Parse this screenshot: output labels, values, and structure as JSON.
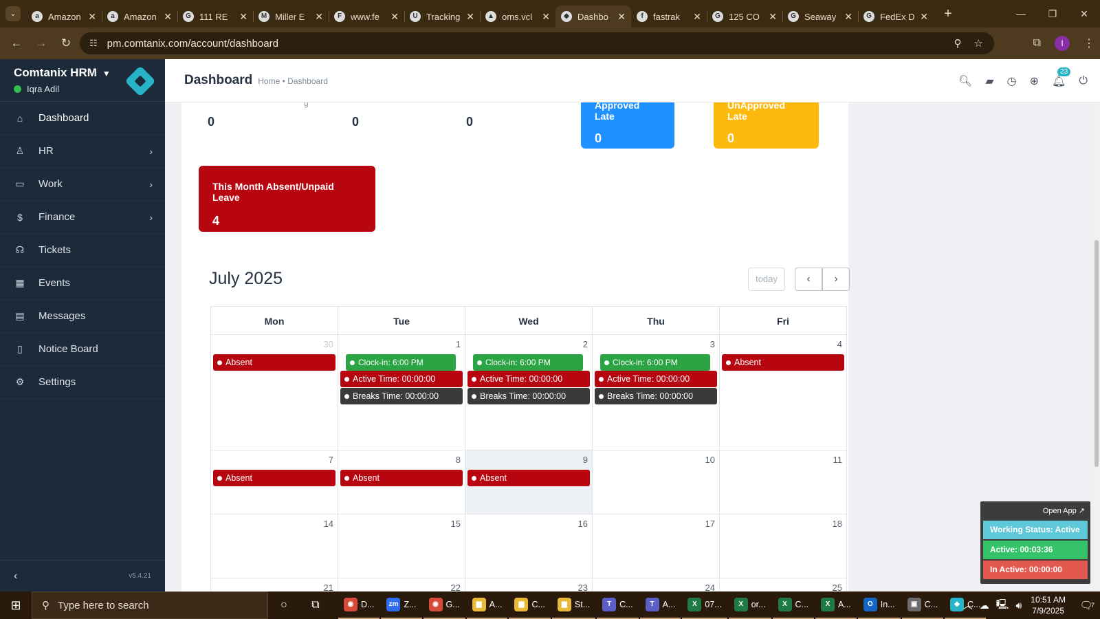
{
  "browser": {
    "tabs": [
      {
        "title": "Amazon",
        "icon": "amazon-icon",
        "fav": "a"
      },
      {
        "title": "Amazon",
        "icon": "amazon-icon",
        "fav": "a"
      },
      {
        "title": "111 RE",
        "icon": "google-icon",
        "fav": "G"
      },
      {
        "title": "Miller E",
        "icon": "miller-icon",
        "fav": "M"
      },
      {
        "title": "www.fe",
        "icon": "fedex-icon",
        "fav": "F"
      },
      {
        "title": "Tracking",
        "icon": "ups-icon",
        "fav": "U"
      },
      {
        "title": "oms.vcl",
        "icon": "oms-icon",
        "fav": "▲"
      },
      {
        "title": "Dashbo",
        "icon": "comtanix-icon",
        "fav": "◆"
      },
      {
        "title": "fastrak",
        "icon": "fastrak-icon",
        "fav": "f"
      },
      {
        "title": "125 CO",
        "icon": "google-icon",
        "fav": "G"
      },
      {
        "title": "Seaway",
        "icon": "google-icon",
        "fav": "G"
      },
      {
        "title": "FedEx D",
        "icon": "google-icon",
        "fav": "G"
      }
    ],
    "url": "pm.comtanix.com/account/dashboard",
    "profile_initial": "I"
  },
  "sidebar": {
    "brand": "Comtanix HRM",
    "user": "Iqra Adil",
    "items": [
      {
        "label": "Dashboard",
        "icon": "home-icon",
        "glyph": "⌂",
        "arrow": false
      },
      {
        "label": "HR",
        "icon": "users-icon",
        "glyph": "♙",
        "arrow": true
      },
      {
        "label": "Work",
        "icon": "briefcase-icon",
        "glyph": "▭",
        "arrow": true
      },
      {
        "label": "Finance",
        "icon": "dollar-icon",
        "glyph": "$",
        "arrow": true
      },
      {
        "label": "Tickets",
        "icon": "headset-icon",
        "glyph": "☊",
        "arrow": false
      },
      {
        "label": "Events",
        "icon": "calendar-icon",
        "glyph": "▦",
        "arrow": false
      },
      {
        "label": "Messages",
        "icon": "message-icon",
        "glyph": "▤",
        "arrow": false
      },
      {
        "label": "Notice Board",
        "icon": "clipboard-icon",
        "glyph": "▯",
        "arrow": false
      },
      {
        "label": "Settings",
        "icon": "gear-icon",
        "glyph": "⚙",
        "arrow": false
      }
    ],
    "version": "v5.4.21"
  },
  "header": {
    "title": "Dashboard",
    "breadcrumb_home": "Home",
    "breadcrumb_sep": "•",
    "breadcrumb_current": "Dashboard",
    "notification_count": "23"
  },
  "stats": {
    "values": [
      "0",
      "0",
      "0"
    ],
    "label_fragment": "g",
    "approved_late_label": "Approved Late",
    "approved_late_value": "0",
    "unapproved_late_label": "UnApproved Late",
    "unapproved_late_value": "0",
    "absent_label": "This Month Absent/Unpaid Leave",
    "absent_value": "4"
  },
  "colors": {
    "approved": "#1e90ff",
    "unapproved": "#fdba0d",
    "absent": "#b7060f"
  },
  "calendar": {
    "title": "July 2025",
    "today_label": "today",
    "days": [
      "Mon",
      "Tue",
      "Wed",
      "Thu",
      "Fri"
    ],
    "weeks": [
      {
        "height": 168,
        "cells": [
          {
            "num": "30",
            "other": true,
            "events": [
              {
                "type": "absent",
                "text": "Absent"
              }
            ]
          },
          {
            "num": "1",
            "events": [
              {
                "type": "clock",
                "text": "Clock-in: 6:00 PM"
              },
              {
                "type": "active",
                "text": "Active Time: 00:00:00"
              },
              {
                "type": "breaks",
                "text": "Breaks Time: 00:00:00"
              }
            ]
          },
          {
            "num": "2",
            "events": [
              {
                "type": "clock",
                "text": "Clock-in: 6:00 PM"
              },
              {
                "type": "active",
                "text": "Active Time: 00:00:00"
              },
              {
                "type": "breaks",
                "text": "Breaks Time: 00:00:00"
              }
            ]
          },
          {
            "num": "3",
            "events": [
              {
                "type": "clock",
                "text": "Clock-in: 6:00 PM"
              },
              {
                "type": "active",
                "text": "Active Time: 00:00:00"
              },
              {
                "type": "breaks",
                "text": "Breaks Time: 00:00:00"
              }
            ]
          },
          {
            "num": "4",
            "events": [
              {
                "type": "absent",
                "text": "Absent"
              }
            ]
          }
        ]
      },
      {
        "height": 93,
        "cells": [
          {
            "num": "7",
            "events": [
              {
                "type": "absent",
                "text": "Absent"
              }
            ]
          },
          {
            "num": "8",
            "events": [
              {
                "type": "absent",
                "text": "Absent"
              }
            ]
          },
          {
            "num": "9",
            "today": true,
            "events": [
              {
                "type": "absent",
                "text": "Absent"
              }
            ]
          },
          {
            "num": "10",
            "events": []
          },
          {
            "num": "11",
            "events": []
          }
        ]
      },
      {
        "height": 93,
        "cells": [
          {
            "num": "14",
            "events": []
          },
          {
            "num": "15",
            "events": []
          },
          {
            "num": "16",
            "events": []
          },
          {
            "num": "17",
            "events": []
          },
          {
            "num": "18",
            "events": []
          }
        ]
      },
      {
        "height": 40,
        "cells": [
          {
            "num": "21",
            "events": []
          },
          {
            "num": "22",
            "events": []
          },
          {
            "num": "23",
            "events": []
          },
          {
            "num": "24",
            "events": []
          },
          {
            "num": "25",
            "events": []
          }
        ]
      }
    ]
  },
  "widget": {
    "open_app": "Open App ↗",
    "working_status": "Working Status: Active",
    "active": "Active: 00:03:36",
    "inactive": "In Active: 00:00:00"
  },
  "taskbar": {
    "search_placeholder": "Type here to search",
    "apps": [
      {
        "label": "D...",
        "color": "#d64a3a",
        "icon": "chrome-icon",
        "glyph": "◉"
      },
      {
        "label": "Z...",
        "color": "#2d6cf0",
        "icon": "zoom-icon",
        "glyph": "zm"
      },
      {
        "label": "G...",
        "color": "#d64a3a",
        "icon": "chrome-icon",
        "glyph": "◉"
      },
      {
        "label": "A...",
        "color": "#e8b936",
        "icon": "folder-icon",
        "glyph": "▆"
      },
      {
        "label": "C...",
        "color": "#e8b936",
        "icon": "folder-icon",
        "glyph": "▆"
      },
      {
        "label": "St...",
        "color": "#e8b936",
        "icon": "folder-icon",
        "glyph": "▆"
      },
      {
        "label": "C...",
        "color": "#5b5fc7",
        "icon": "teams-icon",
        "glyph": "T"
      },
      {
        "label": "A...",
        "color": "#5b5fc7",
        "icon": "teams-icon",
        "glyph": "T"
      },
      {
        "label": "07...",
        "color": "#1f7a45",
        "icon": "excel-icon",
        "glyph": "X"
      },
      {
        "label": "or...",
        "color": "#1f7a45",
        "icon": "excel-icon",
        "glyph": "X"
      },
      {
        "label": "C...",
        "color": "#1f7a45",
        "icon": "excel-icon",
        "glyph": "X"
      },
      {
        "label": "A...",
        "color": "#1f7a45",
        "icon": "excel-icon",
        "glyph": "X"
      },
      {
        "label": "In...",
        "color": "#1466c5",
        "icon": "outlook-icon",
        "glyph": "O"
      },
      {
        "label": "C...",
        "color": "#6b6b6b",
        "icon": "app-icon",
        "glyph": "▣"
      },
      {
        "label": "C...",
        "color": "#27b3c8",
        "icon": "comtanix-icon",
        "glyph": "◆"
      }
    ],
    "time": "10:51 AM",
    "date": "7/9/2025",
    "notif_count": "7"
  }
}
